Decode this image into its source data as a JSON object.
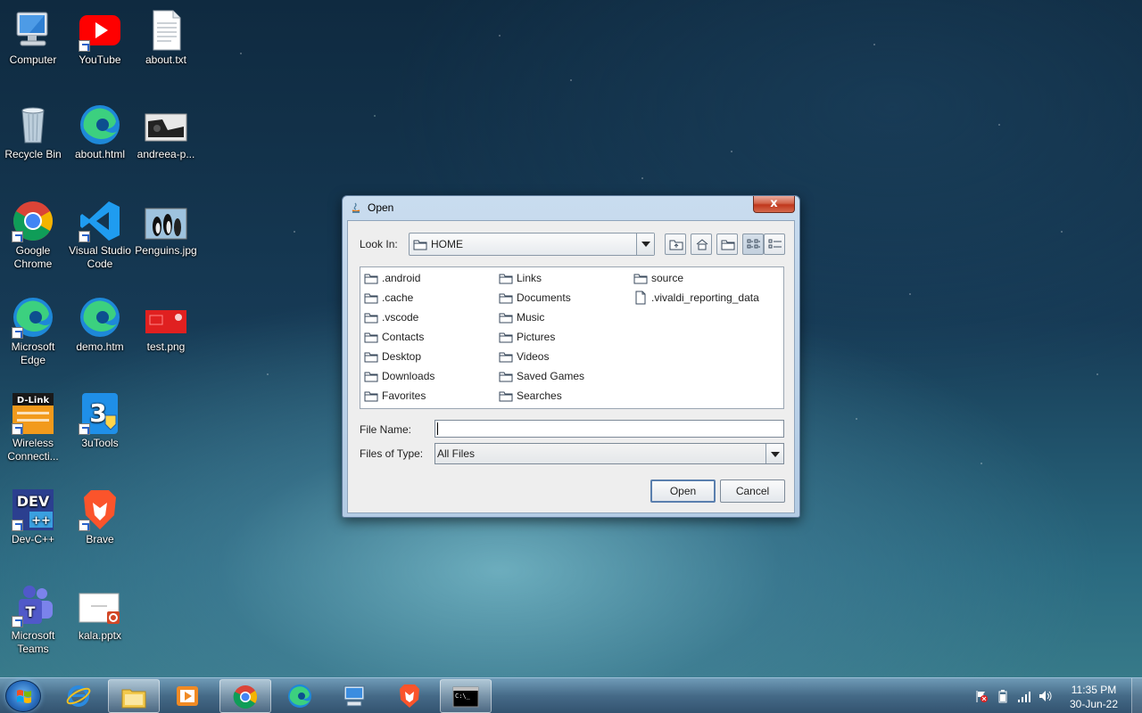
{
  "desktop": {
    "icons": [
      {
        "label": "Computer"
      },
      {
        "label": "YouTube"
      },
      {
        "label": "about.txt"
      },
      {
        "label": "Recycle Bin"
      },
      {
        "label": "about.html"
      },
      {
        "label": "andreea-p..."
      },
      {
        "label": "Google Chrome"
      },
      {
        "label": "Visual Studio Code"
      },
      {
        "label": "Penguins.jpg"
      },
      {
        "label": "Microsoft Edge"
      },
      {
        "label": "demo.htm"
      },
      {
        "label": "test.png"
      },
      {
        "label": "Wireless Connecti..."
      },
      {
        "label": "3uTools"
      },
      {
        "label": "Dev-C++"
      },
      {
        "label": "Brave"
      },
      {
        "label": "Microsoft Teams"
      },
      {
        "label": "kala.pptx"
      }
    ]
  },
  "dialog": {
    "title": "Open",
    "close_label": "x",
    "look_in_label": "Look In:",
    "look_in_value": "HOME",
    "toolbar": [
      "up-folder-icon",
      "home-icon",
      "new-folder-icon",
      "list-view-icon",
      "details-view-icon"
    ],
    "files": [
      {
        "name": ".android",
        "type": "folder"
      },
      {
        "name": ".cache",
        "type": "folder"
      },
      {
        "name": ".vscode",
        "type": "folder"
      },
      {
        "name": "Contacts",
        "type": "folder"
      },
      {
        "name": "Desktop",
        "type": "folder"
      },
      {
        "name": "Downloads",
        "type": "folder"
      },
      {
        "name": "Favorites",
        "type": "folder"
      },
      {
        "name": "Links",
        "type": "folder"
      },
      {
        "name": "Documents",
        "type": "folder"
      },
      {
        "name": "Music",
        "type": "folder"
      },
      {
        "name": "Pictures",
        "type": "folder"
      },
      {
        "name": "Videos",
        "type": "folder"
      },
      {
        "name": "Saved Games",
        "type": "folder"
      },
      {
        "name": "Searches",
        "type": "folder"
      },
      {
        "name": "source",
        "type": "folder"
      },
      {
        "name": ".vivaldi_reporting_data",
        "type": "file"
      }
    ],
    "file_name_label": "File Name:",
    "file_name_value": "",
    "files_of_type_label": "Files of Type:",
    "files_of_type_value": "All Files",
    "open_label": "Open",
    "cancel_label": "Cancel"
  },
  "taskbar": {
    "pinned": [
      "ie-icon",
      "file-explorer-icon",
      "media-player-icon",
      "chrome-icon",
      "edge-icon",
      "remote-desktop-icon",
      "brave-icon",
      "command-prompt-icon"
    ],
    "cmd_label": "C:\\_",
    "time": "11:35 PM",
    "date": "30-Jun-22"
  },
  "colors": {
    "dialog_frame": "#b3cbe4",
    "dialog_client": "#eeeeee",
    "close_button": "#c0371c",
    "folder_fill": "#ffffff",
    "folder_stroke": "#3a4a5c"
  }
}
